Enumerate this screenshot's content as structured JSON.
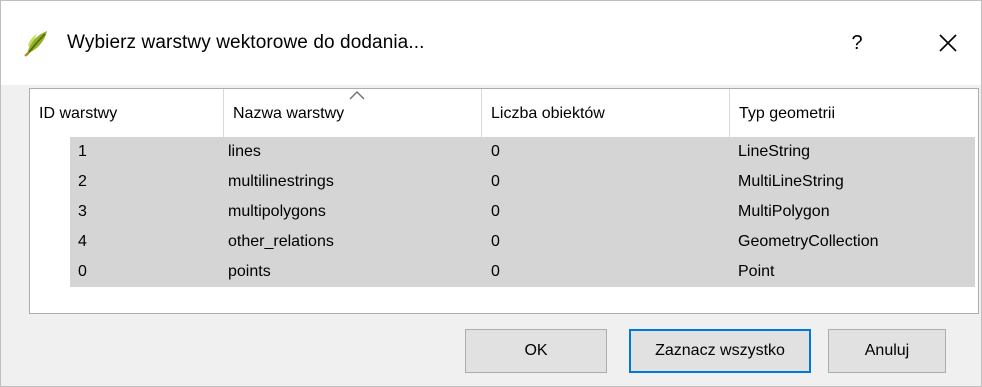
{
  "dialog": {
    "title": "Wybierz warstwy wektorowe do dodania...",
    "help_label": "?",
    "icons": {
      "app": "qgis-logo-icon",
      "close": "close-icon"
    }
  },
  "table": {
    "columns": [
      "ID warstwy",
      "Nazwa warstwy",
      "Liczba obiektów",
      "Typ geometrii"
    ],
    "sorted_column": "Nazwa warstwy",
    "rows": [
      {
        "id": "1",
        "name": "lines",
        "count": "0",
        "type": "LineString"
      },
      {
        "id": "2",
        "name": "multilinestrings",
        "count": "0",
        "type": "MultiLineString"
      },
      {
        "id": "3",
        "name": "multipolygons",
        "count": "0",
        "type": "MultiPolygon"
      },
      {
        "id": "4",
        "name": "other_relations",
        "count": "0",
        "type": "GeometryCollection"
      },
      {
        "id": "0",
        "name": "points",
        "count": "0",
        "type": "Point"
      }
    ]
  },
  "buttons": {
    "ok": "OK",
    "select_all": "Zaznacz wszystko",
    "cancel": "Anuluj"
  },
  "colors": {
    "selection": "#d5d5d5",
    "focus_border": "#0078d7",
    "button_bg": "#e1e1e1",
    "dialog_bg": "#f0f0f0"
  }
}
